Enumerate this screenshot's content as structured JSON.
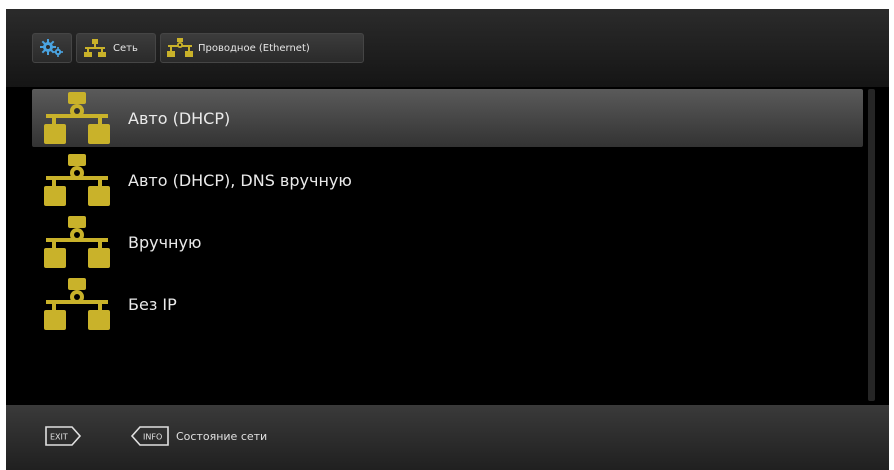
{
  "breadcrumb": {
    "settings_icon": "gears-icon",
    "network_icon": "network-icon",
    "network_label": "Сеть",
    "wired_label": "Проводное (Ethernet)"
  },
  "menu": {
    "items": [
      {
        "label": "Авто (DHCP)",
        "icon": "network-gear-icon",
        "selected": true
      },
      {
        "label": "Авто (DHCP), DNS вручную",
        "icon": "network-gear-icon",
        "selected": false
      },
      {
        "label": "Вручную",
        "icon": "network-gear-icon",
        "selected": false
      },
      {
        "label": "Без IP",
        "icon": "network-gear-icon",
        "selected": false
      }
    ]
  },
  "footer": {
    "exit_key": "EXIT",
    "info_key": "INFO",
    "info_label": "Состояние сети"
  },
  "colors": {
    "accent": "#c9b22a",
    "background": "#000000",
    "selected_row": "#4a4a4a"
  }
}
